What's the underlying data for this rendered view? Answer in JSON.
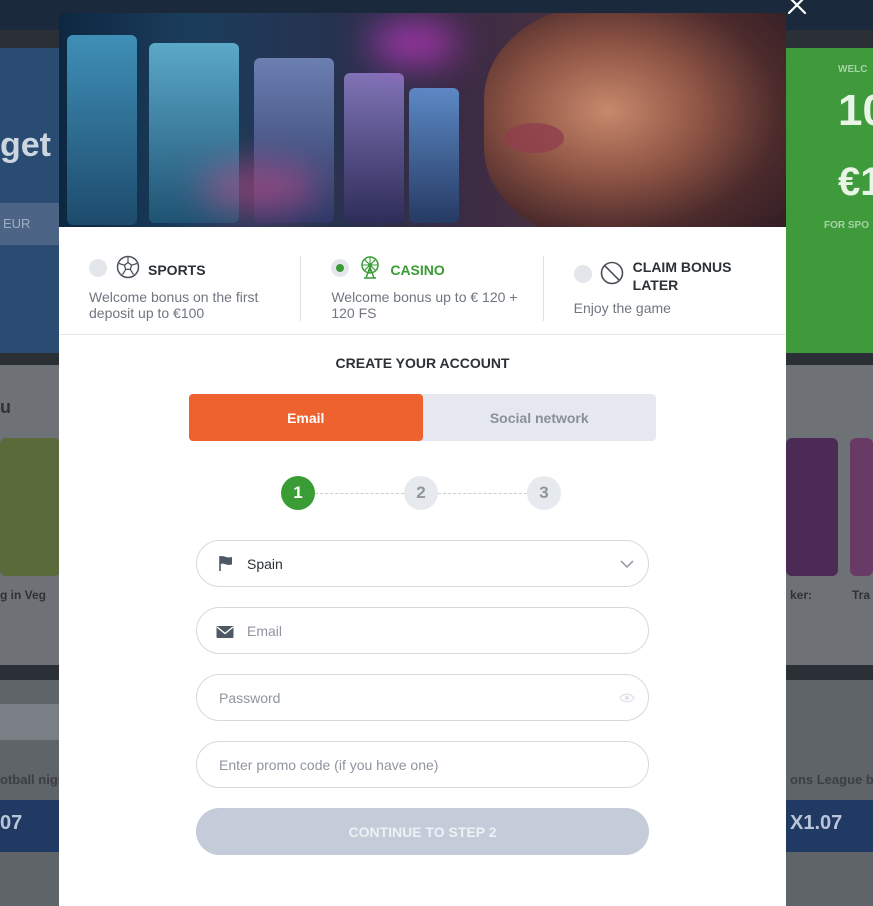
{
  "bonus": {
    "sports": {
      "title": "SPORTS",
      "desc": "Welcome bonus on the first deposit up to €100",
      "selected": false
    },
    "casino": {
      "title": "CASINO",
      "desc": "Welcome bonus up to € 120 + 120 FS",
      "selected": true
    },
    "later": {
      "title": "CLAIM BONUS LATER",
      "desc": "Enjoy the game",
      "selected": false
    }
  },
  "account": {
    "title": "CREATE YOUR ACCOUNT",
    "tabs": [
      {
        "label": "Email",
        "active": true
      },
      {
        "label": "Social network",
        "active": false
      }
    ],
    "steps": [
      "1",
      "2",
      "3"
    ],
    "current_step": 1
  },
  "form": {
    "country": "Spain",
    "email_placeholder": "Email",
    "password_placeholder": "Password",
    "promo_placeholder": "Enter promo code (if you have one)",
    "submit_label": "CONTINUE TO STEP 2"
  },
  "colors": {
    "accent_orange": "#ee622f",
    "accent_green": "#3a9c35",
    "button_disabled": "#c3ccd8"
  },
  "icons": [
    "close-icon",
    "soccer-ball-icon",
    "ferris-wheel-icon",
    "no-entry-icon",
    "flag-icon",
    "chevron-down-icon",
    "envelope-icon",
    "eye-icon"
  ]
}
